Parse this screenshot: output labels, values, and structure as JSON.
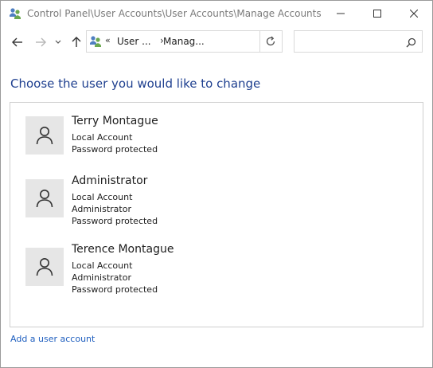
{
  "window": {
    "title": "Control Panel\\User Accounts\\User Accounts\\Manage Accounts",
    "icon": "users-icon"
  },
  "nav": {
    "back_icon": "arrow-left-icon",
    "forward_icon": "arrow-right-icon",
    "recent_icon": "chevron-down-icon",
    "up_icon": "arrow-up-icon"
  },
  "address": {
    "overflow_chevron": "«",
    "segments": [
      "User ...",
      "Manag..."
    ],
    "separator": "›",
    "refresh_icon": "refresh-icon"
  },
  "search": {
    "placeholder": "",
    "value": ""
  },
  "main": {
    "heading": "Choose the user you would like to change",
    "accounts": [
      {
        "name": "Terry Montague",
        "details": [
          "Local Account",
          "Password protected"
        ]
      },
      {
        "name": "Administrator",
        "details": [
          "Local Account",
          "Administrator",
          "Password protected"
        ]
      },
      {
        "name": "Terence Montague",
        "details": [
          "Local Account",
          "Administrator",
          "Password protected"
        ]
      }
    ],
    "add_link": "Add a user account"
  },
  "colors": {
    "heading": "#1e3f8f",
    "link": "#1f5fbf",
    "avatar_bg": "#e6e6e6"
  }
}
